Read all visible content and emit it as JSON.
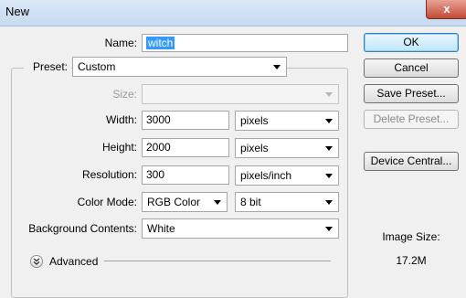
{
  "window": {
    "title": "New",
    "close_glyph": "x"
  },
  "name": {
    "label": "Name:",
    "value": "witch"
  },
  "preset": {
    "label": "Preset:",
    "value": "Custom"
  },
  "size": {
    "label": "Size:",
    "value": ""
  },
  "width": {
    "label": "Width:",
    "value": "3000",
    "unit": "pixels"
  },
  "height": {
    "label": "Height:",
    "value": "2000",
    "unit": "pixels"
  },
  "resolution": {
    "label": "Resolution:",
    "value": "300",
    "unit": "pixels/inch"
  },
  "color_mode": {
    "label": "Color Mode:",
    "value": "RGB Color",
    "depth": "8 bit"
  },
  "background": {
    "label": "Background Contents:",
    "value": "White"
  },
  "advanced": {
    "label": "Advanced"
  },
  "buttons": {
    "ok": "OK",
    "cancel": "Cancel",
    "save_preset": "Save Preset...",
    "delete_preset": "Delete Preset...",
    "device_central": "Device Central..."
  },
  "image_size": {
    "label": "Image Size:",
    "value": "17.2M"
  }
}
